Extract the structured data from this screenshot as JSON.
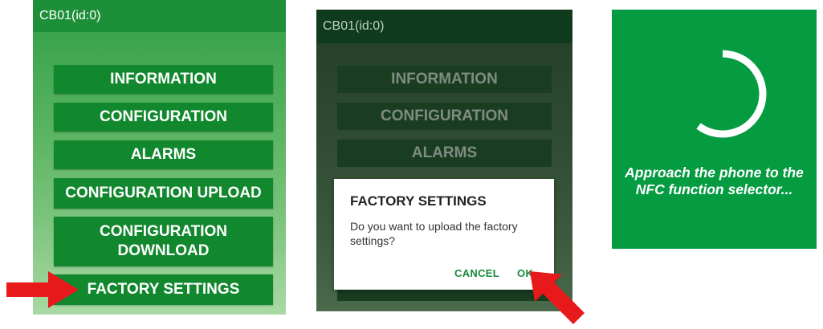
{
  "screen1": {
    "title": "CB01(id:0)",
    "buttons": [
      "INFORMATION",
      "CONFIGURATION",
      "ALARMS",
      "CONFIGURATION UPLOAD",
      "CONFIGURATION DOWNLOAD",
      "FACTORY SETTINGS"
    ]
  },
  "screen2": {
    "title": "CB01(id:0)",
    "buttons": [
      "INFORMATION",
      "CONFIGURATION",
      "ALARMS"
    ],
    "dialog": {
      "title": "FACTORY SETTINGS",
      "message": "Do you want to upload the factory settings?",
      "cancel": "CANCEL",
      "ok": "OK"
    }
  },
  "screen3": {
    "message": "Approach the phone to the NFC function selector..."
  },
  "colors": {
    "app_green": "#12882e",
    "nfc_bg": "#049b41",
    "arrow_red": "#e8191b",
    "dialog_action": "#1a8a3a"
  }
}
